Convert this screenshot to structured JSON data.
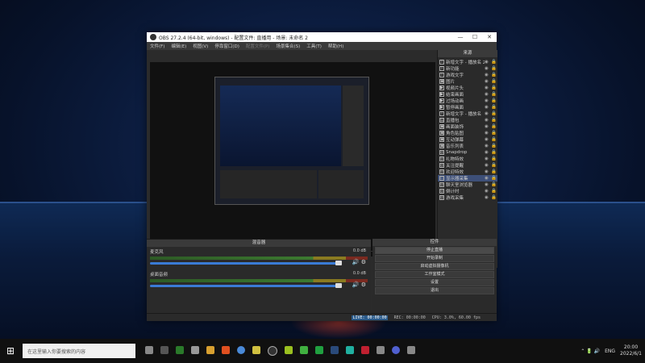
{
  "window": {
    "title": "OBS 27.2.4 (64-bit, windows) - 配置文件: 直播用 - 场景: 未命名 2",
    "menu": [
      "文件(F)",
      "编辑(E)",
      "视图(V)",
      "停靠窗口(D)",
      "配置文件(P)",
      "场景集合(S)",
      "工具(T)",
      "帮助(H)"
    ]
  },
  "sources": {
    "header": "来源",
    "items": [
      {
        "icon": "text-icon",
        "name": "新增文字 - 播放名 2"
      },
      {
        "icon": "text-icon",
        "name": "新功能"
      },
      {
        "icon": "text-icon",
        "name": "游戏文字"
      },
      {
        "icon": "image-icon",
        "name": "图片"
      },
      {
        "icon": "play-icon",
        "name": "视频片头"
      },
      {
        "icon": "play-icon",
        "name": "结束画面"
      },
      {
        "icon": "play-icon",
        "name": "过场动画"
      },
      {
        "icon": "play-icon",
        "name": "暂停画面"
      },
      {
        "icon": "text-icon",
        "name": "新增文字 - 播放名"
      },
      {
        "icon": "folder-icon",
        "name": "直播包"
      },
      {
        "icon": "image-icon",
        "name": "画面装饰"
      },
      {
        "icon": "image-icon",
        "name": "角色贴图"
      },
      {
        "icon": "image-icon",
        "name": "互动弹幕"
      },
      {
        "icon": "image-icon",
        "name": "音乐列表"
      },
      {
        "icon": "globe-icon",
        "name": "Snapdrop"
      },
      {
        "icon": "globe-icon",
        "name": "礼物特效"
      },
      {
        "icon": "globe-icon",
        "name": "关注提醒"
      },
      {
        "icon": "globe-icon",
        "name": "欢迎特效"
      },
      {
        "icon": "monitor-icon",
        "name": "显示器采集"
      },
      {
        "icon": "globe-icon",
        "name": "聊天室浏览器"
      },
      {
        "icon": "globe-icon",
        "name": "倒计时"
      },
      {
        "icon": "globe-icon",
        "name": "游戏采集"
      }
    ],
    "selected_index": 18,
    "tools": [
      "+",
      "−",
      "⚙",
      "⌃",
      "⌄"
    ]
  },
  "mixer": {
    "header": "混音器",
    "channels": [
      {
        "name": "麦克风",
        "db": "0.0 dB"
      },
      {
        "name": "桌面音频",
        "db": "0.0 dB"
      }
    ]
  },
  "controls": {
    "header": "控件",
    "buttons": [
      "停止直播",
      "开始录制",
      "启动虚拟摄像机",
      "工作室模式",
      "设置",
      "退出"
    ]
  },
  "status": {
    "live": "LIVE: 00:00:00",
    "rec": "REC: 00:00:00",
    "cpu": "CPU: 3.0%, 60.00 fps"
  },
  "taskbar": {
    "search_placeholder": "在这里输入你要搜索的内容",
    "lang": "ENG",
    "time": "20:00",
    "date": "2022/6/1"
  }
}
